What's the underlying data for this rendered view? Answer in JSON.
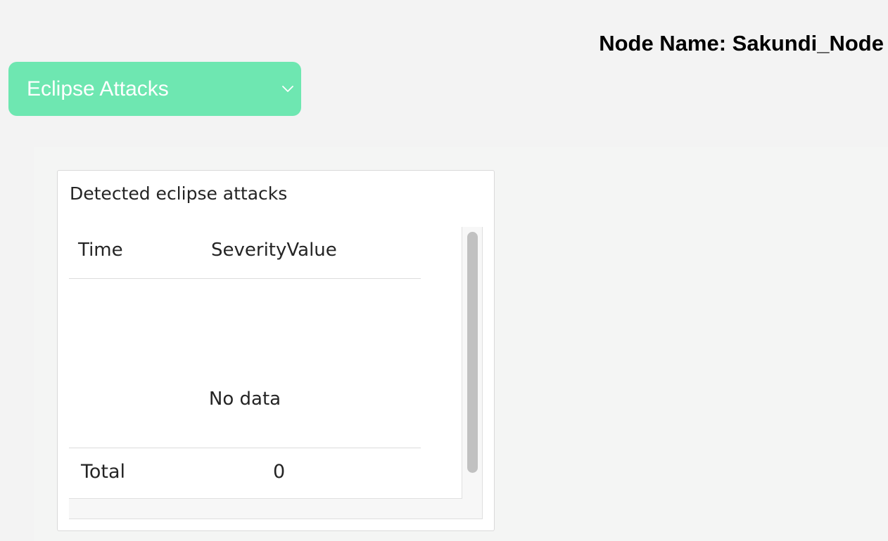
{
  "header": {
    "node_name": "Node Name: Sakundi_Node"
  },
  "view_selector": {
    "selected": "Eclipse Attacks",
    "icon": "chevron-down-icon",
    "color": "#6ee7b1"
  },
  "card": {
    "title": "Detected eclipse attacks",
    "table": {
      "columns": [
        "Time",
        "SeverityValue"
      ],
      "rows": [],
      "empty_text": "No data",
      "total_label": "Total",
      "total_value": "0"
    }
  }
}
